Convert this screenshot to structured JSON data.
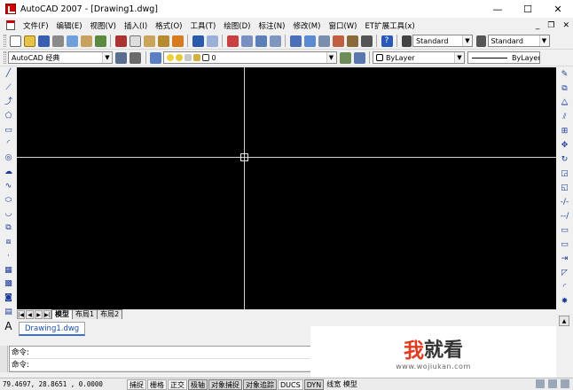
{
  "window": {
    "title": "AutoCAD 2007 - [Drawing1.dwg]",
    "minimize_glyph": "—",
    "maximize_glyph": "☐",
    "close_glyph": "✕"
  },
  "menu": {
    "items": [
      "文件(F)",
      "编辑(E)",
      "视图(V)",
      "插入(I)",
      "格式(O)",
      "工具(T)",
      "绘图(D)",
      "标注(N)",
      "修改(M)",
      "窗口(W)",
      "ET扩展工具(x)"
    ],
    "mdi_minimize": "_",
    "mdi_restore": "❐",
    "mdi_close": "✕"
  },
  "toolbar": {
    "text_style": "Standard",
    "dim_style": "Standard",
    "workspace": "AutoCAD 经典",
    "layer": "0",
    "color": "ByLayer",
    "linetype": "ByLayer"
  },
  "layout_tabs": {
    "tabs": [
      "模型",
      "布局1",
      "布局2"
    ],
    "active": 0
  },
  "document_tabs": {
    "tabs": [
      "Drawing1.dwg"
    ]
  },
  "command": {
    "lines": [
      "命令:",
      "命令:"
    ]
  },
  "watermark": {
    "brand_first": "我",
    "brand_rest": "就看",
    "url": "www.wojiukan.com"
  },
  "statusbar": {
    "coordinates": "79.4697,  28.8651 , 0.0000",
    "toggles": [
      "捕捉",
      "栅格",
      "正交",
      "极轴",
      "对象捕捉",
      "对象追踪",
      "DUCS",
      "DYN"
    ],
    "model_label": "线宽 模型"
  },
  "colors": {
    "canvas_bg": "#000000",
    "crosshair": "#cfcfcf",
    "accent": "#1a4db3"
  }
}
